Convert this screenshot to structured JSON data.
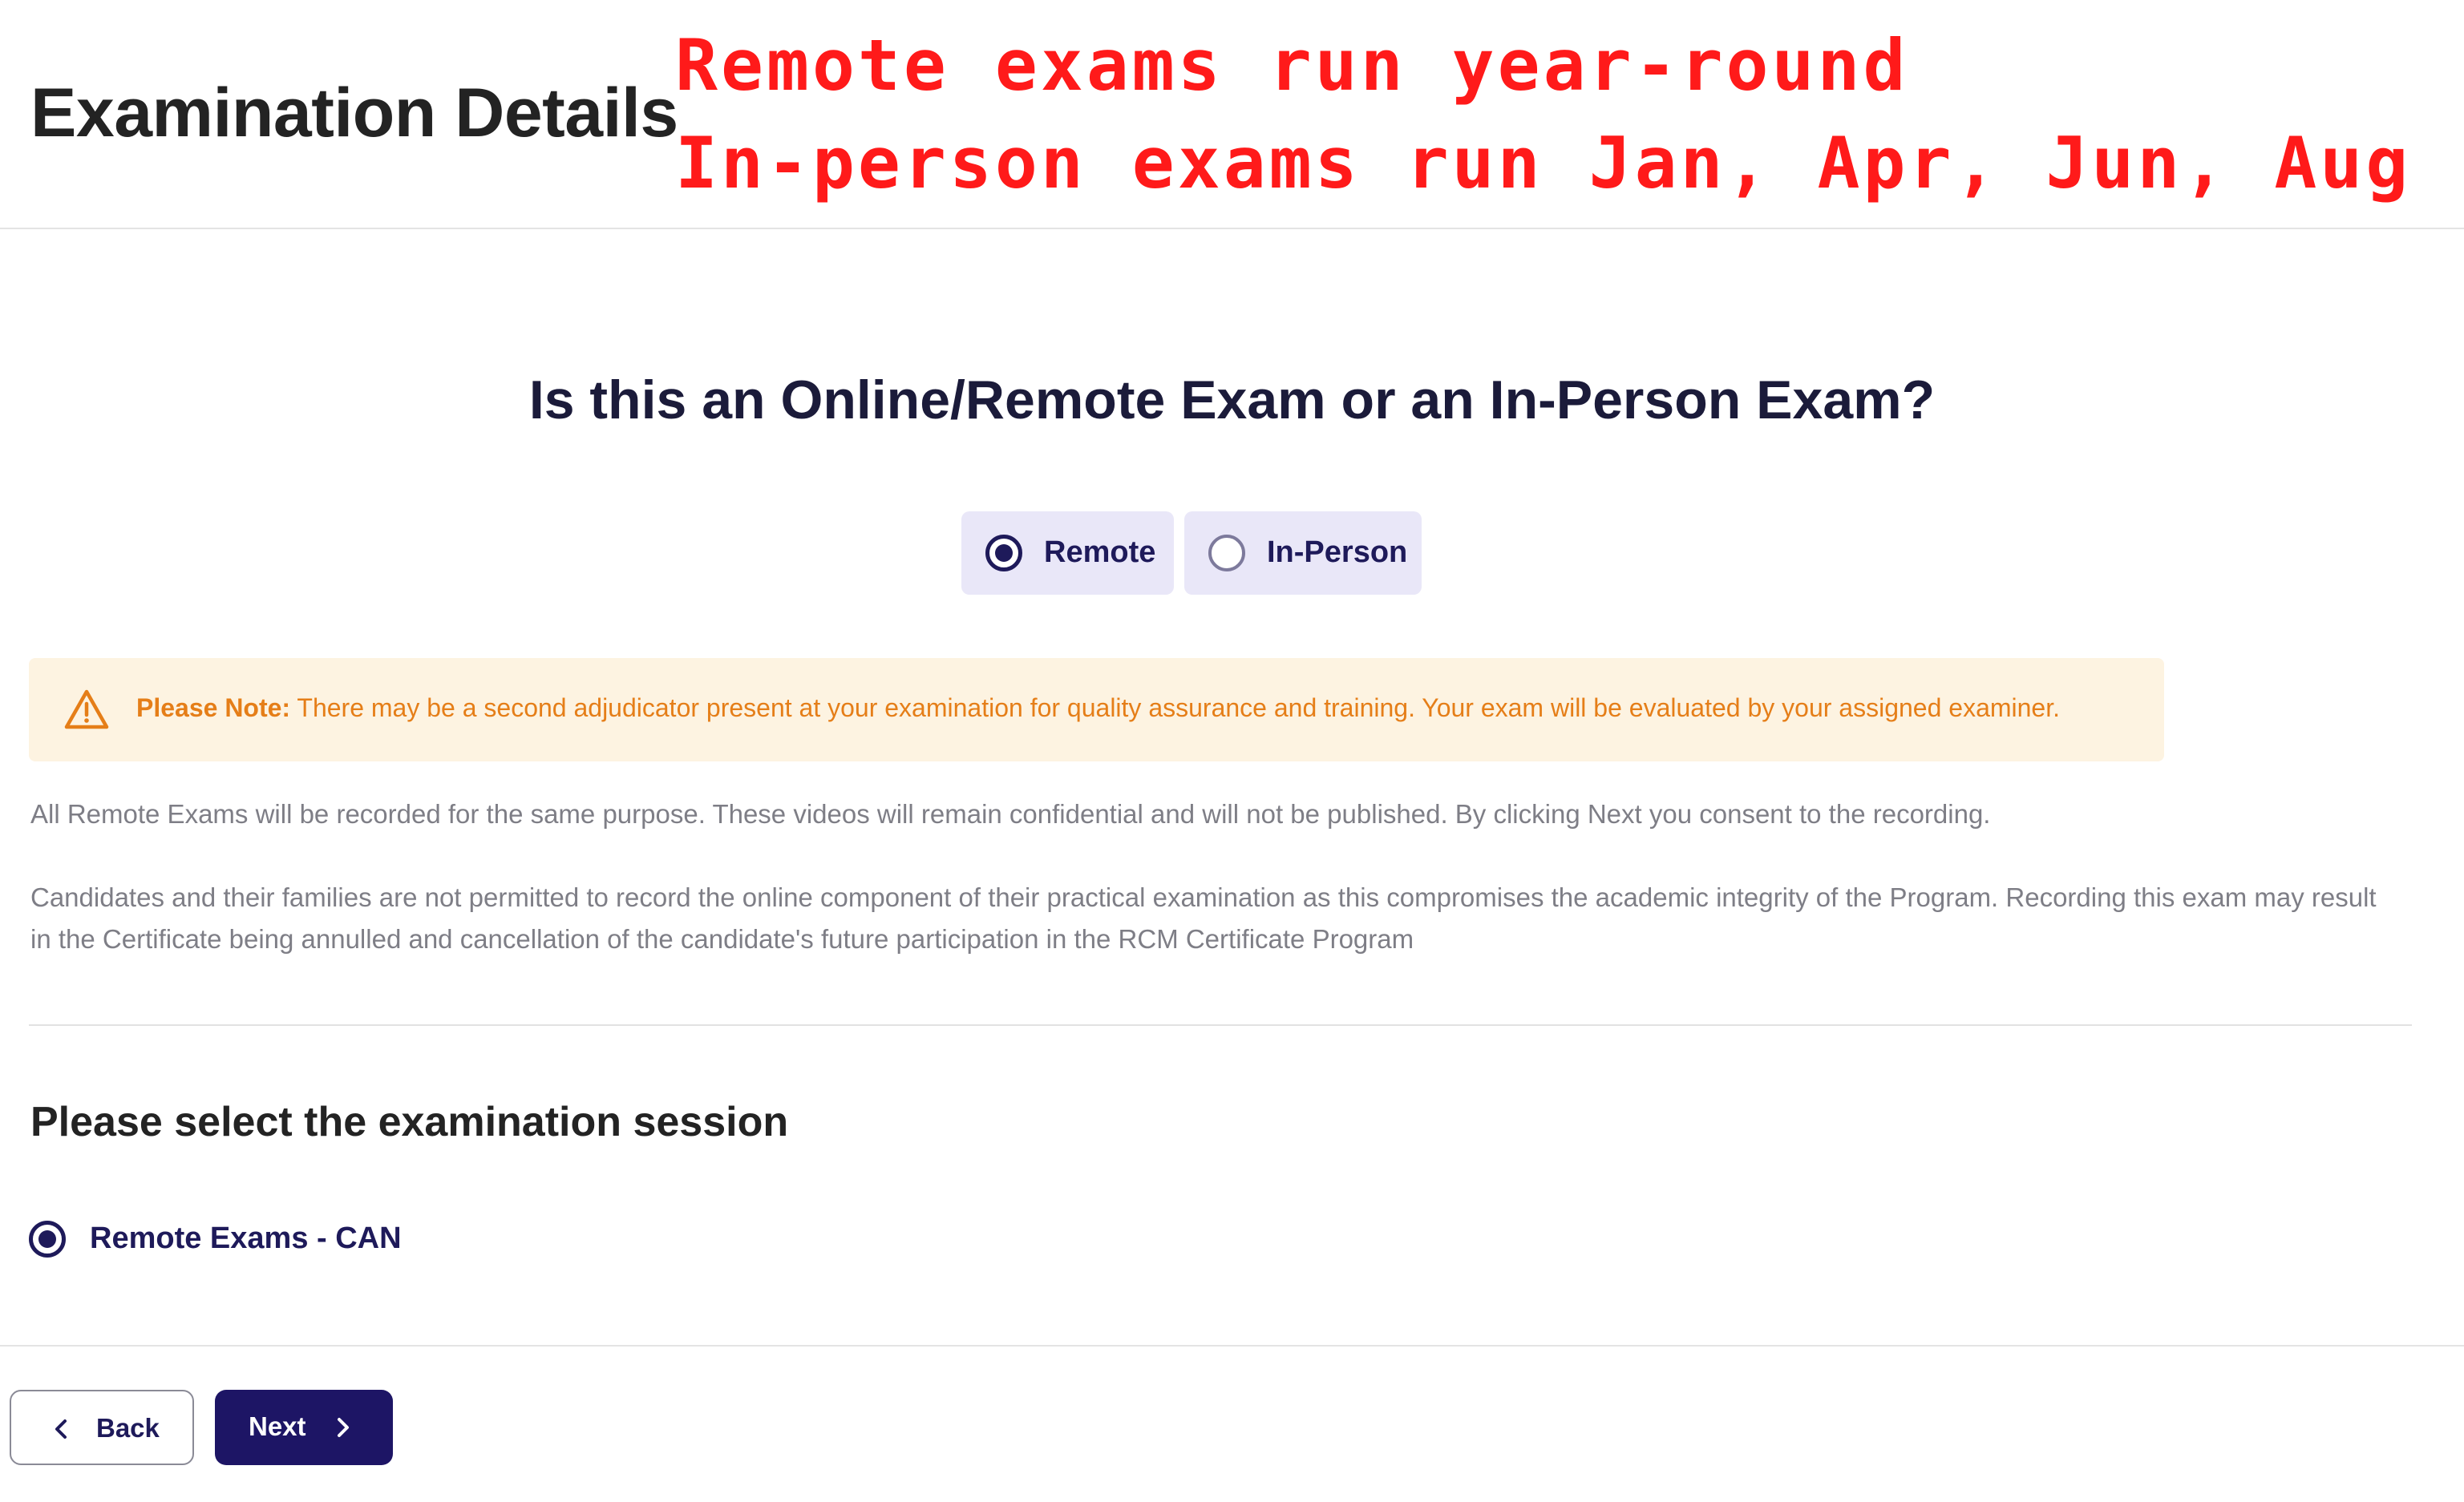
{
  "header": {
    "title": "Examination Details",
    "annotation_line1": "Remote exams run year-round",
    "annotation_line2": "In-person exams run Jan, Apr, Jun, Aug",
    "annotation_color": "#ff1a1a"
  },
  "question": {
    "text": "Is this an Online/Remote Exam or an In-Person Exam?",
    "options": [
      {
        "label": "Remote",
        "selected": true
      },
      {
        "label": "In-Person",
        "selected": false
      }
    ]
  },
  "notice": {
    "icon": "warning-triangle-icon",
    "lead": "Please Note:",
    "text": " There may be a second adjudicator present at your examination for quality assurance and training. Your exam will be evaluated by your assigned examiner.",
    "color": "#e57e18",
    "background": "#fdf3e1"
  },
  "paragraphs": {
    "p1": "All Remote Exams will be recorded for the same purpose. These videos will remain confidential and will not be published. By clicking Next you consent to the recording.",
    "p2": "Candidates and their families are not permitted to record the online component of their practical examination as this compromises the academic integrity of the Program. Recording this exam may result in the Certificate being annulled and cancellation of the candidate's future participation in the RCM Certificate Program"
  },
  "session": {
    "title": "Please select the examination session",
    "options": [
      {
        "label": "Remote Exams - CAN",
        "selected": true
      }
    ]
  },
  "footer": {
    "back_label": "Back",
    "next_label": "Next",
    "back_icon": "chevron-left-icon",
    "next_icon": "chevron-right-icon",
    "primary_color": "#1d1565"
  }
}
